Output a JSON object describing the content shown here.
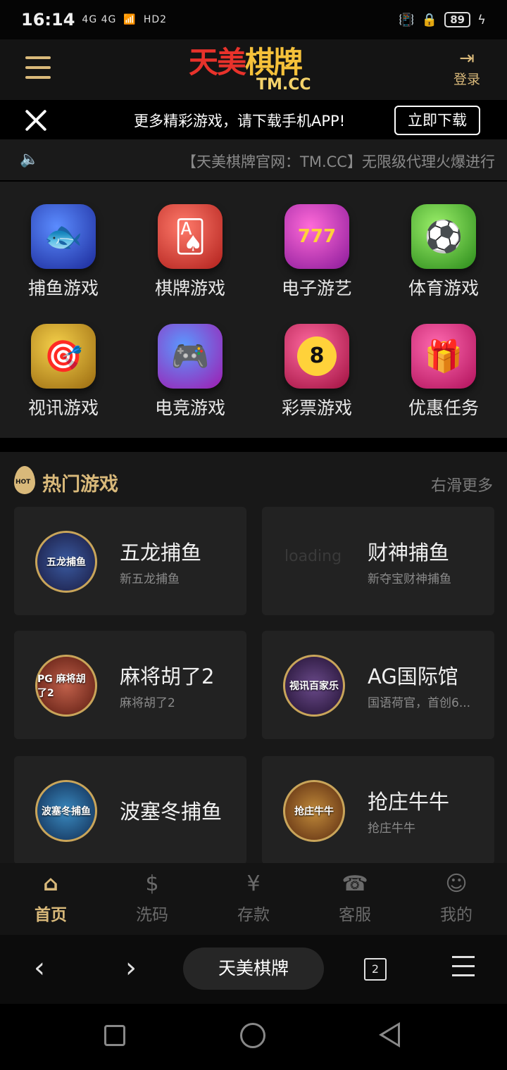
{
  "status_bar": {
    "time": "16:14",
    "network": "4G 4G",
    "hd": "HD2",
    "battery": "89"
  },
  "header": {
    "logo_cn_1": "天美",
    "logo_cn_2": "棋牌",
    "logo_en": "TM.CC",
    "login_label": "登录"
  },
  "banner": {
    "message": "更多精彩游戏，请下载手机APP!",
    "download_label": "立即下载"
  },
  "marquee": {
    "text": "【天美棋牌官网：TM.CC】无限级代理火爆进行"
  },
  "categories": [
    {
      "label": "捕鱼游戏",
      "icon": "fish-icon"
    },
    {
      "label": "棋牌游戏",
      "icon": "cards-icon"
    },
    {
      "label": "电子游艺",
      "icon": "slot-icon"
    },
    {
      "label": "体育游戏",
      "icon": "soccer-icon"
    },
    {
      "label": "视讯游戏",
      "icon": "roulette-icon"
    },
    {
      "label": "电竞游戏",
      "icon": "gamepad-icon"
    },
    {
      "label": "彩票游戏",
      "icon": "billiard-8-icon"
    },
    {
      "label": "优惠任务",
      "icon": "gift-icon"
    }
  ],
  "hot": {
    "badge": "HOT",
    "title": "热门游戏",
    "more": "右滑更多",
    "games": [
      {
        "name": "五龙捕鱼",
        "sub": "新五龙捕鱼",
        "thumb": "五龙捕鱼"
      },
      {
        "name": "财神捕鱼",
        "sub": "新夺宝财神捕鱼",
        "thumb": "loading"
      },
      {
        "name": "麻将胡了2",
        "sub": "麻将胡了2",
        "thumb": "PG 麻将胡了2"
      },
      {
        "name": "AG国际馆",
        "sub": "国语荷官，首创6...",
        "thumb": "视讯百家乐"
      },
      {
        "name": "波塞冬捕鱼",
        "sub": "",
        "thumb": "波塞冬捕鱼"
      },
      {
        "name": "抢庄牛牛",
        "sub": "抢庄牛牛",
        "thumb": "抢庄牛牛"
      }
    ]
  },
  "tabbar": {
    "items": [
      {
        "label": "首页",
        "icon": "home-icon"
      },
      {
        "label": "洗码",
        "icon": "dollar-circle-icon"
      },
      {
        "label": "存款",
        "icon": "deposit-icon"
      },
      {
        "label": "客服",
        "icon": "support-icon"
      },
      {
        "label": "我的",
        "icon": "user-icon"
      }
    ],
    "active": "首页"
  },
  "browser": {
    "title": "天美棋牌",
    "tab_count": "2"
  },
  "colors": {
    "accent_gold": "#d9b97a",
    "background": "#181818"
  }
}
